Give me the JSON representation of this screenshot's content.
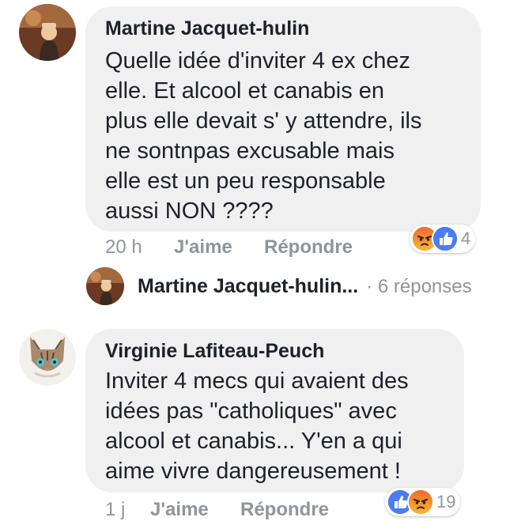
{
  "comments": [
    {
      "author": "Martine Jacquet-hulin",
      "lines": [
        "Quelle idée d'inviter 4 ex chez",
        "elle. Et alcool et canabis en",
        "plus elle devait s' y attendre, ils",
        "ne sontnpas excusable mais",
        "elle est un peu responsable",
        "aussi NON ????"
      ],
      "time": "20 h",
      "like_label": "J'aime",
      "reply_label": "Répondre",
      "reactions": [
        "angry",
        "like"
      ],
      "reaction_count": "4",
      "replies": {
        "author": "Martine Jacquet-hulin...",
        "count_text": "· 6 réponses"
      }
    },
    {
      "author": "Virginie Lafiteau-Peuch",
      "lines": [
        "Inviter 4 mecs qui avaient des",
        "idées pas \"catholiques\" avec",
        "alcool et canabis... Y'en a qui",
        "aime vivre dangereusement !"
      ],
      "time": "1 j",
      "like_label": "J'aime",
      "reply_label": "Répondre",
      "reactions": [
        "like",
        "angry"
      ],
      "reaction_count": "19"
    }
  ],
  "colors": {
    "bubble": "#f1f0f0",
    "meta": "#90949c",
    "like_blue": "#4a7df3",
    "angry_orange": "#f06a2f"
  }
}
